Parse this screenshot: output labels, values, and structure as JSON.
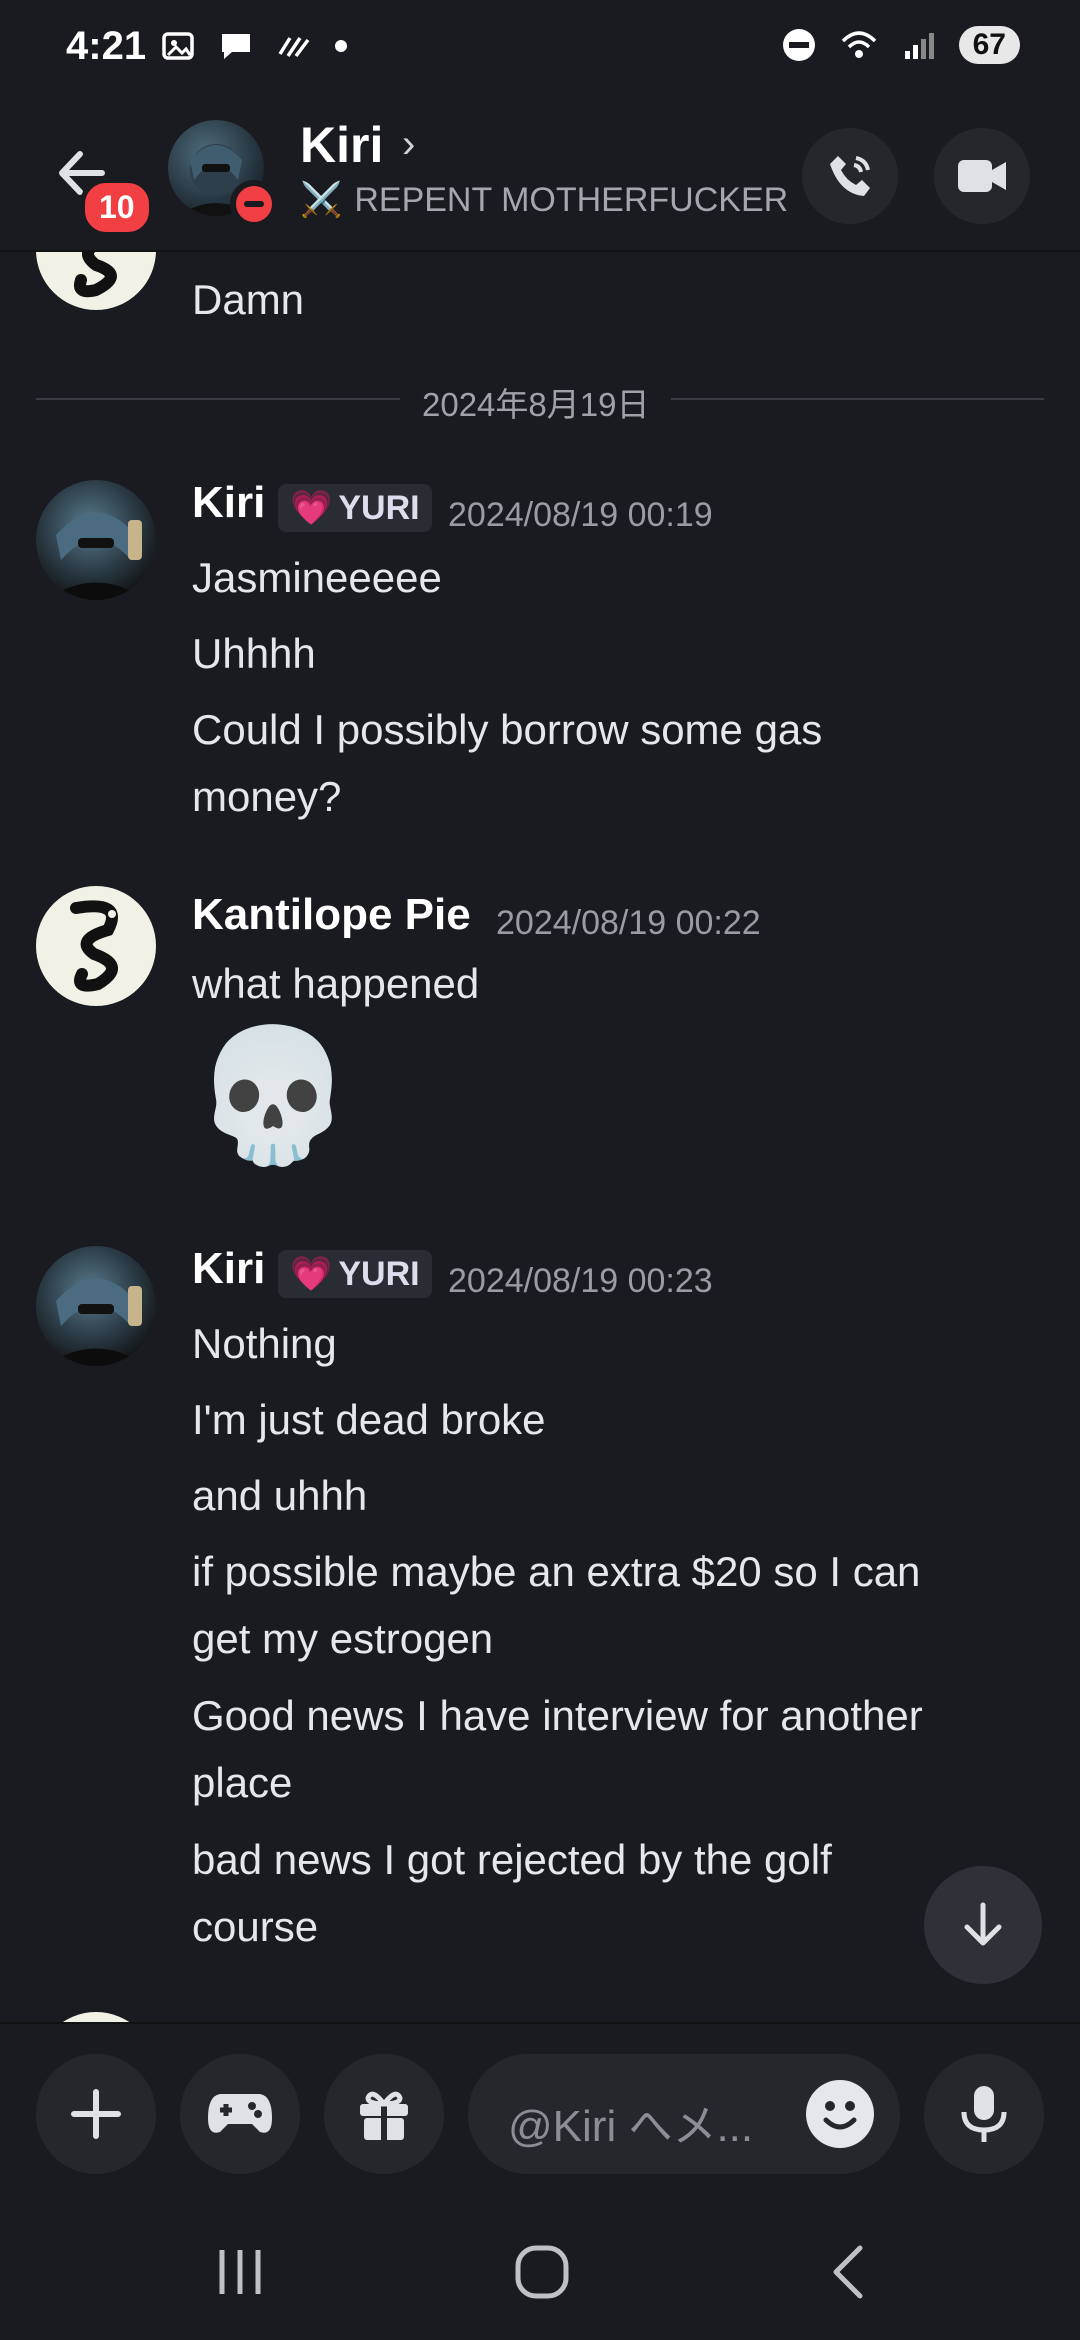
{
  "status_bar": {
    "time": "4:21",
    "battery": "67",
    "icons": [
      "screenshot-icon",
      "chat-bubble-icon",
      "slash-icon",
      "dot-icon",
      "dnd-icon",
      "wifi-icon",
      "signal-icon"
    ]
  },
  "header": {
    "name": "Kiri",
    "status": "REPENT MOTHERFUCKER",
    "status_emoji": "⚔️",
    "unread_badge": "10"
  },
  "chat": {
    "prev_message": "Damn",
    "date_divider": "2024年8月19日",
    "groups": [
      {
        "author": "Kiri",
        "tag": "YURI",
        "timestamp": "2024/08/19 00:19",
        "lines": [
          "Jasmineeeee",
          "Uhhhh",
          "Could I possibly borrow some gas",
          "money?"
        ]
      },
      {
        "author": "Kantilope Pie",
        "timestamp": "2024/08/19 00:22",
        "lines": [
          "what happened"
        ],
        "emoji": "💀"
      },
      {
        "author": "Kiri",
        "tag": "YURI",
        "timestamp": "2024/08/19 00:23",
        "lines": [
          "Nothing",
          "I'm just dead broke",
          "and uhhh",
          "if possible maybe an extra $20 so I can",
          "get my estrogen",
          "Good news I have interview for another",
          "place",
          "bad news I got rejected by the golf",
          "course"
        ]
      }
    ]
  },
  "composer": {
    "placeholder": "@Kiri へメ..."
  },
  "colors": {
    "background": "#1a1b20",
    "badge_red": "#f23f43",
    "button_bg": "#26272d"
  }
}
